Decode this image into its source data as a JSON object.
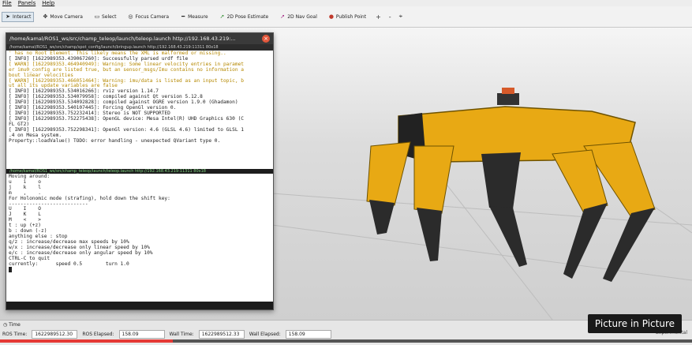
{
  "menu": [
    "File",
    "Panels",
    "Help"
  ],
  "toolbar": [
    {
      "label": "Interact",
      "icon": "cursor-icon"
    },
    {
      "label": "Move Camera",
      "icon": "move-camera-icon"
    },
    {
      "label": "Select",
      "icon": "select-icon"
    },
    {
      "label": "Focus Camera",
      "icon": "focus-camera-icon"
    },
    {
      "label": "Measure",
      "icon": "measure-icon"
    },
    {
      "label": "2D Pose Estimate",
      "icon": "pose-estimate-icon"
    },
    {
      "label": "2D Nav Goal",
      "icon": "nav-goal-icon"
    },
    {
      "label": "Publish Point",
      "icon": "publish-point-icon"
    }
  ],
  "toolbar_extras": [
    "+",
    "-",
    "⌖"
  ],
  "terminal": {
    "title": "/home/kamal/ROS1_ws/src/champ_teleop/launch/teleop.launch http://192.168.43.219:...",
    "tab": "/home/kamal/ROS1_ws/src/champ/spot_config/launch/bringup.launch http://192.168.43.219:11311 80x18",
    "pane1": [
      {
        "text": "' has no Root Element. This likely means the XML is malformed or missing..",
        "warn": true
      },
      {
        "text": "[ INFO] [1622989353.439067260]: Successfully parsed urdf file",
        "warn": false
      },
      {
        "text": "[ WARN] [1622989353.464940949]: Warning: Some linear velocity entries in paramet",
        "warn": true
      },
      {
        "text": "er imu0_config are listed true, but an sensor_msgs/Imu contains no information a",
        "warn": true
      },
      {
        "text": "bout linear velocities",
        "warn": true
      },
      {
        "text": "[ WARN] [1622989353.466051464]: Warning: imu/data is listed as an input topic, b",
        "warn": true
      },
      {
        "text": "ut all its update variables are false",
        "warn": true
      },
      {
        "text": "[ INFO] [1622989353.534016266]: rviz version 1.14.7",
        "warn": false
      },
      {
        "text": "[ INFO] [1622989353.534079958]: compiled against Qt version 5.12.8",
        "warn": false
      },
      {
        "text": "[ INFO] [1622989353.534092828]: compiled against OGRE version 1.9.0 (Ghadamon)",
        "warn": false
      },
      {
        "text": "[ INFO] [1622989353.540107445]: Forcing OpenGl version 0.",
        "warn": false
      },
      {
        "text": "[ INFO] [1622989353.752232414]: Stereo is NOT SUPPORTED",
        "warn": false
      },
      {
        "text": "[ INFO] [1622989353.752275438]: OpenGL device: Mesa Intel(R) UHD Graphics 630 (C",
        "warn": false
      },
      {
        "text": "FL GT2)",
        "warn": false
      },
      {
        "text": "[ INFO] [1622989353.752298341]: OpenGl version: 4.6 (GLSL 4.6) limited to GLSL 1",
        "warn": false
      },
      {
        "text": ".4 on Mesa system.",
        "warn": false
      },
      {
        "text": "Property::loadValue() TODO: error handling - unexpected QVariant type 0.",
        "warn": false
      }
    ],
    "divider": "/home/kamal/ROS1_ws/src/champ_teleop/launch/teleop.launch http://192.168.43.219:11311 80x18",
    "pane2": [
      "Moving around:",
      "u    i    o",
      "j    k    l",
      "m    ,    .",
      "For Holonomic mode (strafing), hold down the shift key:",
      "---------------------------",
      "U    I    O",
      "J    K    L",
      "M    <    >",
      "t : up (+z)",
      "b : down (-z)",
      "anything else : stop",
      "q/z : increase/decrease max speeds by 10%",
      "w/x : increase/decrease only linear speed by 10%",
      "e/c : increase/decrease only angular speed by 10%",
      "CTRL-C to quit",
      "",
      "currently:      speed 0.5        turn 1.0"
    ]
  },
  "time_panel": {
    "label": "Time"
  },
  "status": {
    "ros_time_label": "ROS Time:",
    "ros_time": "1622989512.30",
    "ros_elapsed_label": "ROS Elapsed:",
    "ros_elapsed": "158.09",
    "wall_time_label": "Wall Time:",
    "wall_time": "1622989512.33",
    "wall_elapsed_label": "Wall Elapsed:",
    "wall_elapsed": "158.09",
    "experimental": "Experimental"
  },
  "video": {
    "pip_label": "Picture in Picture",
    "progress": 0.25
  },
  "colors": {
    "robot_body": "#e8a914",
    "robot_legs": "#2b2b2b",
    "progress": "#e53935"
  }
}
